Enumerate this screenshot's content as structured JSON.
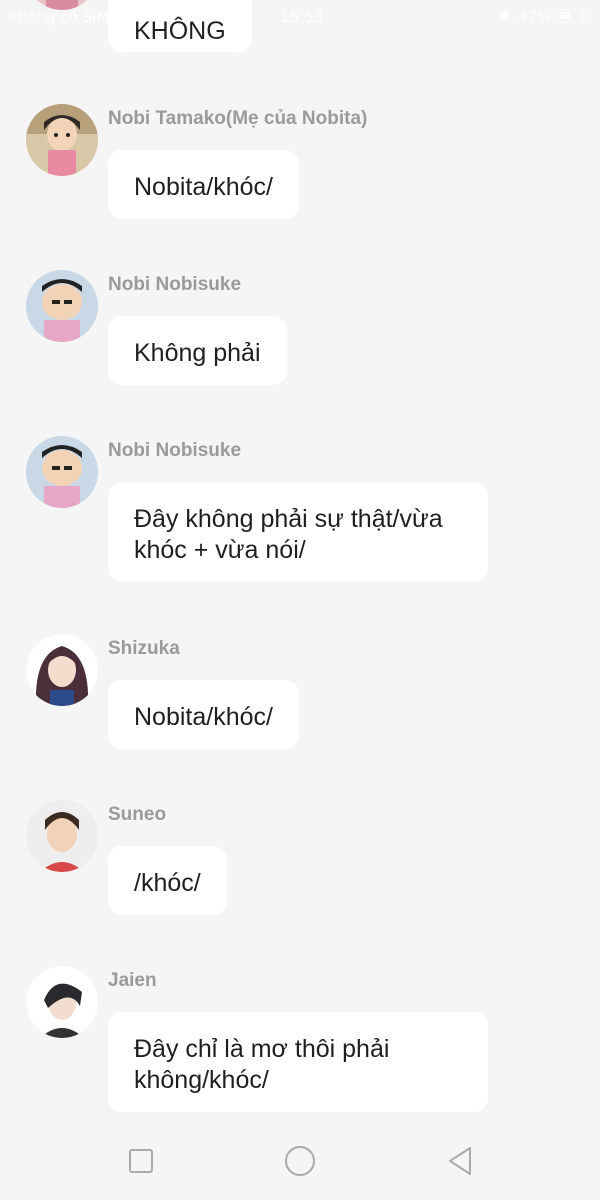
{
  "status_bar": {
    "carrier": "Không có SIM",
    "time": "15:53",
    "battery_percent": "47%",
    "battery_level": 0.47,
    "bluetooth_icon": "bluetooth-icon"
  },
  "messages": [
    {
      "sender": "",
      "text": "KHÔNG",
      "avatar": "avatar-cropped"
    },
    {
      "sender": "Nobi Tamako(Mẹ của Nobita)",
      "text": "Nobita/khóc/",
      "avatar": "avatar-tamako"
    },
    {
      "sender": "Nobi Nobisuke",
      "text": "Không phải",
      "avatar": "avatar-nobisuke"
    },
    {
      "sender": "Nobi Nobisuke",
      "text": "Đây không phải sự thật/vừa khóc + vừa nói/",
      "avatar": "avatar-nobisuke"
    },
    {
      "sender": "Shizuka",
      "text": "Nobita/khóc/",
      "avatar": "avatar-shizuka"
    },
    {
      "sender": "Suneo",
      "text": "/khóc/",
      "avatar": "avatar-suneo"
    },
    {
      "sender": "Jaien",
      "text": "Đây chỉ là mơ thôi phải không/khóc/",
      "avatar": "avatar-jaien"
    }
  ],
  "nav_bar": {
    "recent_icon": "square-icon",
    "home_icon": "circle-icon",
    "back_icon": "triangle-back-icon"
  },
  "colors": {
    "background": "#f5f5f5",
    "bubble": "#ffffff",
    "sender_text": "#9a9a9a",
    "message_text": "#1f1f1f"
  }
}
